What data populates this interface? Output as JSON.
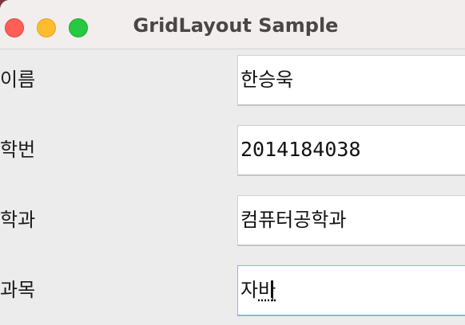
{
  "window": {
    "title": "GridLayout Sample"
  },
  "form": {
    "rows": [
      {
        "label": "이름",
        "value": "한승욱"
      },
      {
        "label": "학번",
        "value": "2014184038"
      },
      {
        "label": "학과",
        "value": "컴퓨터공학과"
      },
      {
        "label": "과목",
        "value_committed": "자",
        "value_composing": "바"
      }
    ],
    "focused_row": "과목"
  },
  "colors": {
    "close": "#ff5f57",
    "minimize": "#febc2e",
    "zoom": "#28c840",
    "focus_ring": "#8ab4ee"
  }
}
